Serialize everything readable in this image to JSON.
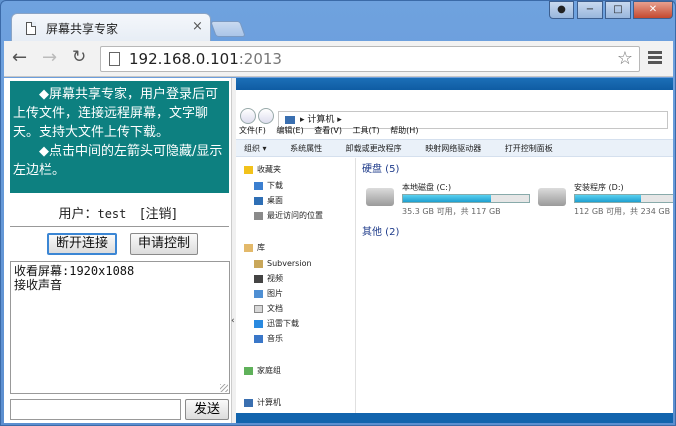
{
  "browser": {
    "tab_title": "屏幕共享专家",
    "tab_close": "×",
    "url_host": "192.168.0.101",
    "url_port": ":2013"
  },
  "window_controls": {
    "minimize": "−",
    "maximize": "□",
    "close": "✕"
  },
  "panel": {
    "info_line1": "◆屏幕共享专家，用户登录后可上传文件，连接远程屏幕，文字聊天。支持大文件上传下载。",
    "info_line2": "◆点击中间的左箭头可隐藏/显示左边栏。",
    "user_label": "用户：",
    "user_name": "test",
    "logout": "[注销]",
    "disconnect_button": "断开连接",
    "request_control_button": "申请控制",
    "log_lines": [
      "收看屏幕:1920x1088",
      "接收声音"
    ],
    "chat_value": "",
    "send_button": "发送",
    "toggle_arrow": "‹"
  },
  "remote": {
    "address_path": "▸ 计算机 ▸",
    "menus": [
      "文件(F)",
      "编辑(E)",
      "查看(V)",
      "工具(T)",
      "帮助(H)"
    ],
    "commands": [
      "组织 ▾",
      "系统属性",
      "卸载或更改程序",
      "映射网络驱动器",
      "打开控制面板"
    ],
    "sidebar": [
      "收藏夹",
      "下载",
      "桌面",
      "最近访问的位置",
      "库",
      "Subversion",
      "视频",
      "图片",
      "文档",
      "迅雷下载",
      "音乐",
      "家庭组",
      "计算机"
    ],
    "hard_disks_group": "硬盘 (5)",
    "other_group": "其他 (2)",
    "drives": [
      {
        "name": "本地磁盘 (C:)",
        "detail": "35.3 GB 可用，共 117 GB",
        "used_fraction": 0.7
      },
      {
        "name": "安装程序 (D:)",
        "detail": "112 GB 可用，共 234 GB",
        "used_fraction": 0.52
      }
    ]
  },
  "colors": {
    "info_panel": "#0d8080",
    "remote_title_bar": "#1c6fb7"
  }
}
